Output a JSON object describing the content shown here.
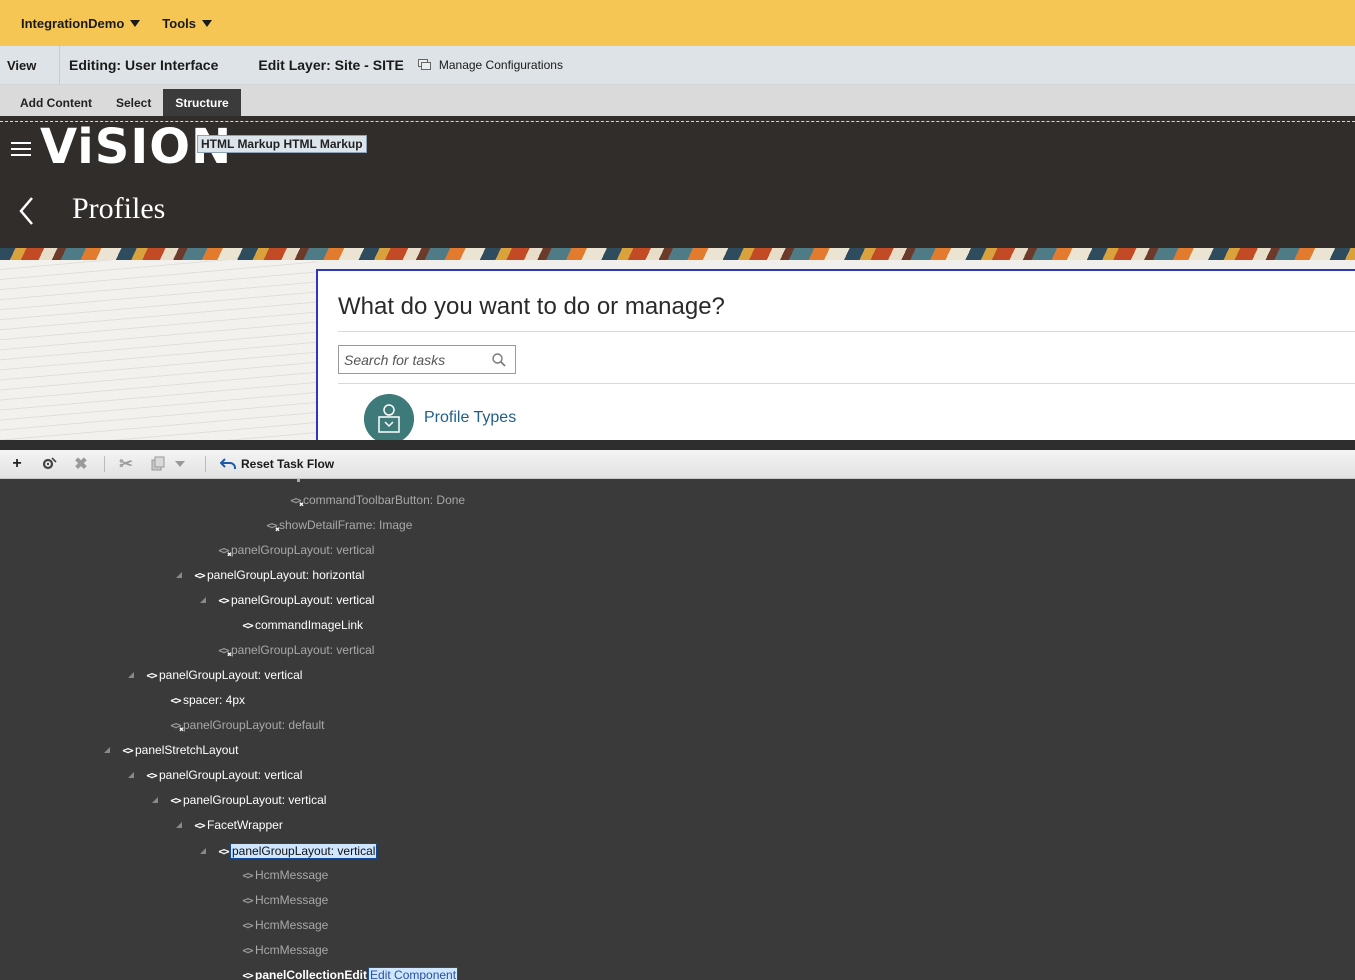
{
  "topbar": {
    "app_menu": "IntegrationDemo",
    "tools_menu": "Tools"
  },
  "composer": {
    "view": "View",
    "editing": "Editing: User Interface",
    "edit_layer": "Edit Layer: Site - SITE",
    "manage": "Manage Configurations"
  },
  "tabs": [
    {
      "label": "Add Content",
      "active": false
    },
    {
      "label": "Select",
      "active": false
    },
    {
      "label": "Structure",
      "active": true
    }
  ],
  "header": {
    "logo": "ViSION",
    "html_markup": "HTML Markup HTML Markup",
    "page_title": "Profiles"
  },
  "panel": {
    "title": "What do you want to do or manage?",
    "search_placeholder": "Search for tasks",
    "profile_link": "Profile Types"
  },
  "tree_toolbar": {
    "reset": "Reset Task Flow"
  },
  "tree": [
    {
      "label": "commandToolbarButton: Done",
      "dim": true,
      "hidden_marker": true
    },
    {
      "label": "showDetailFrame: Image",
      "dim": true,
      "hidden_marker": true
    },
    {
      "label": "panelGroupLayout: vertical",
      "dim": true,
      "hidden_marker": true
    },
    {
      "label": "panelGroupLayout: horizontal",
      "dim": false
    },
    {
      "label": "panelGroupLayout: vertical",
      "dim": false
    },
    {
      "label": "commandImageLink",
      "dim": false
    },
    {
      "label": "panelGroupLayout: vertical",
      "dim": true,
      "hidden_marker": true
    },
    {
      "label": "panelGroupLayout: vertical",
      "dim": false
    },
    {
      "label": "spacer: 4px",
      "dim": false
    },
    {
      "label": "panelGroupLayout: default",
      "dim": true,
      "hidden_marker": true
    },
    {
      "label": "panelStretchLayout",
      "dim": false
    },
    {
      "label": "panelGroupLayout: vertical",
      "dim": false
    },
    {
      "label": "panelGroupLayout: vertical",
      "dim": false
    },
    {
      "label": "FacetWrapper",
      "dim": false
    },
    {
      "label": "panelGroupLayout: vertical",
      "dim": false,
      "selected": true
    },
    {
      "label": "HcmMessage",
      "dim": true
    },
    {
      "label": "HcmMessage",
      "dim": true
    },
    {
      "label": "HcmMessage",
      "dim": true
    },
    {
      "label": "HcmMessage",
      "dim": true
    },
    {
      "label": "panelCollectionEdit",
      "dim": false
    }
  ],
  "edit_component": "Edit Component",
  "colors": {
    "topbar": "#f5c653",
    "header": "#312d2a",
    "tree_bg": "#3a3a3a",
    "selection": "#cfe6ff",
    "link": "#1f5f88",
    "panel_border": "#2b36c7"
  }
}
